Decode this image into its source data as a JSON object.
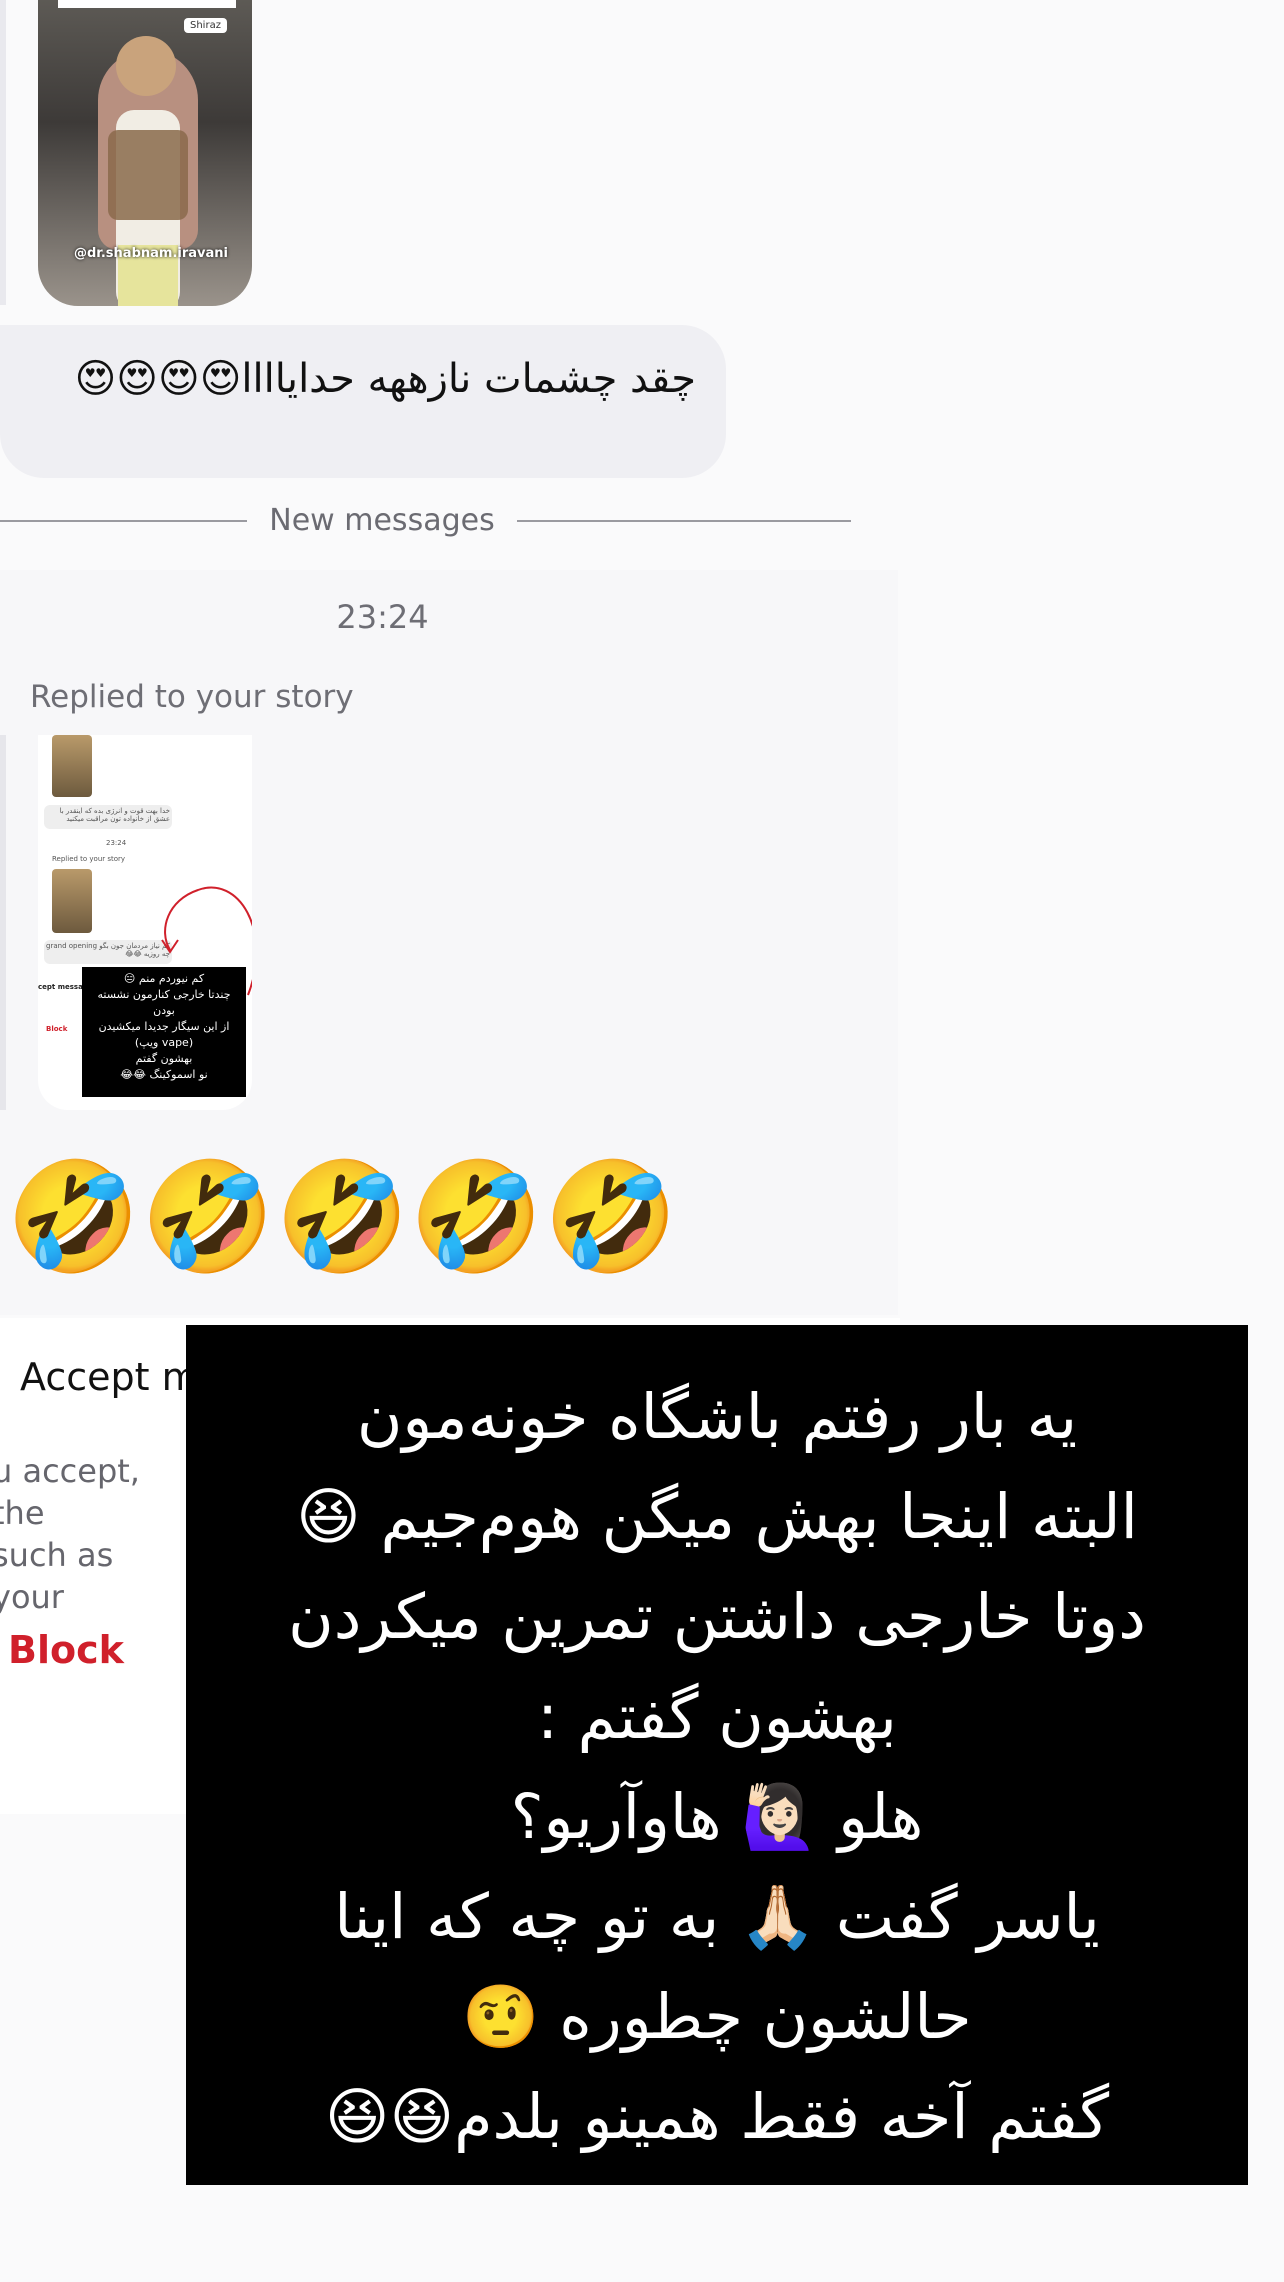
{
  "story_top": {
    "location_tag": "Shiraz",
    "handle": "@dr.shabnam.iravani"
  },
  "message_bubble": {
    "text": "چقد چشمات نازههه حدایاااا😍😍😍😍"
  },
  "divider": {
    "label": "New messages"
  },
  "conversation": {
    "timestamp": "23:24",
    "replied_label": "Replied to your story",
    "mini_story": {
      "bubble_text": "خدا بهت قوت و انرژی بده که اینقدر با عشق از خانواده تون مراقبت میکنید",
      "time": "23:24",
      "replied": "Replied to your story",
      "reply_text": "کم نیاز مردمان جون بگو grand opening چه روزیه 😂😂",
      "accept": "cept messag",
      "block": "Block",
      "black_lines": [
        "کم نیوردم منم 😑",
        "چندتا خارجی کنارمون نشسته",
        "بودن",
        "از این سیگار جدیدا میکشیدن",
        "(vape ویپ)",
        "بهشون گفتم",
        "نو اسموکینگ 😂😂"
      ]
    },
    "emoji_reply": "🤣🤣🤣🤣🤣"
  },
  "request_panel": {
    "accept_title": "Accept m",
    "accept_desc_1": "u accept, the",
    "accept_desc_2": "such as your",
    "block_label": "Block"
  },
  "overlay_card": {
    "lines": [
      "یه بار رفتم باشگاه خونه‌مون",
      "البته اینجا بهش میگن هوم‌جیم 😆",
      "دوتا خارجی داشتن تمرین میکردن",
      "بهشون گفتم :",
      "هلو 🙋🏻‍♀️ هاوآریو؟",
      "یاسر گفت 🙏🏻 به تو چه که اینا",
      "حالشون چطوره 🤨",
      "گفتم آخه فقط همینو بلدم😆😆"
    ]
  },
  "colors": {
    "bubble_bg": "#efeff3",
    "block_red": "#d0202b",
    "muted_text": "#6e6e75"
  }
}
